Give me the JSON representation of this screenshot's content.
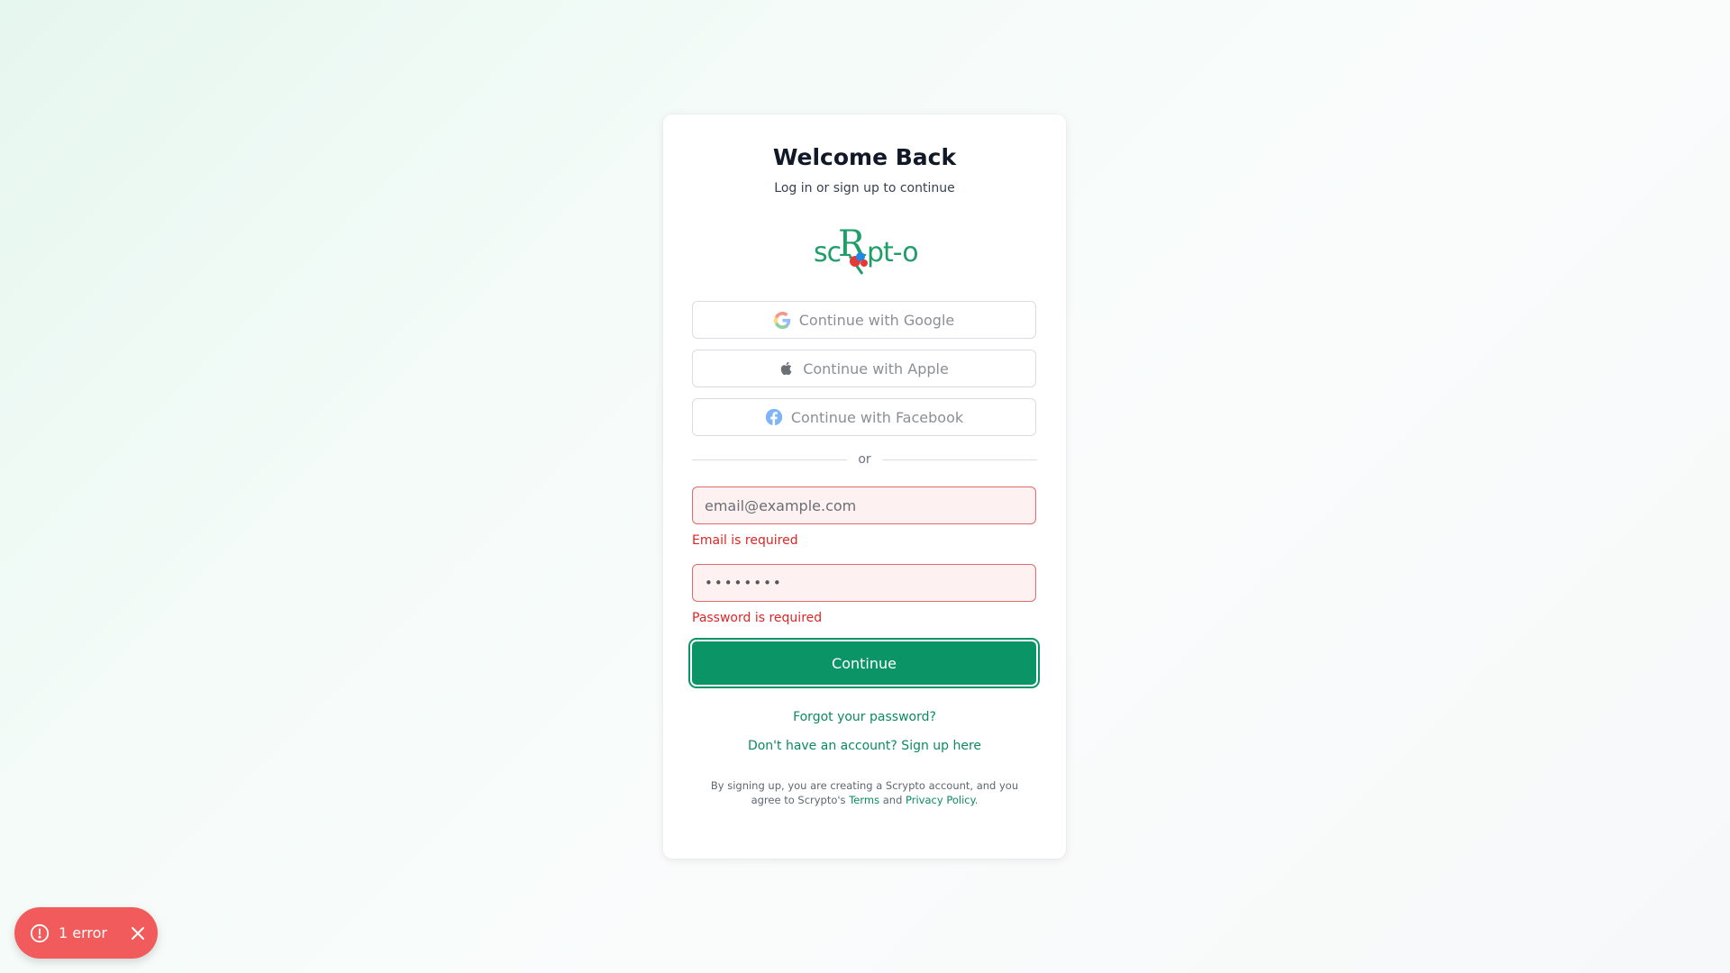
{
  "header": {
    "title": "Welcome Back",
    "subtitle": "Log in or sign up to continue"
  },
  "logo": {
    "text": "scRypt-O",
    "brand_color": "#1f9e6a"
  },
  "social": {
    "google_label": "Continue with Google",
    "apple_label": "Continue with Apple",
    "facebook_label": "Continue with Facebook"
  },
  "divider": {
    "label": "or"
  },
  "form": {
    "email_placeholder": "email@example.com",
    "email_error": "Email is required",
    "password_value": "••••••••",
    "password_error": "Password is required",
    "continue_label": "Continue"
  },
  "links": {
    "forgot_password": "Forgot your password?",
    "signup": "Don't have an account? Sign up here"
  },
  "legal": {
    "prefix": "By signing up, you are creating a Scrypto account, and you agree to Scrypto's",
    "terms": "Terms",
    "and": "and",
    "privacy": "Privacy Policy",
    "suffix": "."
  },
  "toast": {
    "label": "1 error"
  },
  "colors": {
    "accent": "#0b9466",
    "error": "#dc2626",
    "toast_bg": "#f25b5b"
  },
  "icons": {
    "google": "google-icon",
    "apple": "apple-icon",
    "facebook": "facebook-icon",
    "toast_error": "alert-circle-icon",
    "toast_close": "close-icon"
  }
}
